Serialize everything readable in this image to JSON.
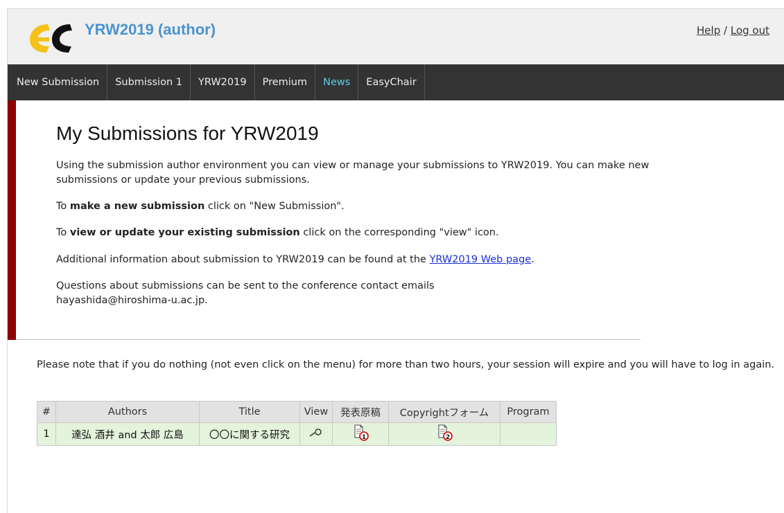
{
  "header": {
    "title": "YRW2019 (author)",
    "help_link": "Help",
    "separator": "/",
    "logout_link": "Log out"
  },
  "menu": {
    "items": [
      {
        "label": "New Submission"
      },
      {
        "label": "Submission 1"
      },
      {
        "label": "YRW2019"
      },
      {
        "label": "Premium"
      },
      {
        "label": "News"
      },
      {
        "label": "EasyChair"
      }
    ],
    "active_item": "News"
  },
  "content": {
    "title": "My Submissions for YRW2019",
    "intro": "Using the submission author environment you can view or manage your submissions to YRW2019. You can make new submissions or update your previous submissions.",
    "new_prefix": "To ",
    "new_bold": "make a new submission",
    "new_suffix": " click on \"New Submission\".",
    "view_prefix": "To ",
    "view_bold": "view or update your existing submission",
    "view_suffix": " click on the corresponding \"view\" icon.",
    "info_prefix": "Additional information about submission to YRW2019 can be found at the ",
    "info_link": "YRW2019 Web page",
    "info_suffix": ".",
    "questions_text": "Questions about submissions can be sent to the conference contact emails",
    "contact_email": "hayashida@hiroshima-u.ac.jp."
  },
  "session_note": "Please note that if you do nothing (not even click on the menu) for more than two hours, your session will expire and you will have to log in again.",
  "table": {
    "columns": [
      "#",
      "Authors",
      "Title",
      "View",
      "発表原稿",
      "Copyrightフォーム",
      "Program"
    ],
    "rows": [
      {
        "num": "1",
        "authors": "達弘 酒井 and 太郎 広島",
        "title": "〇〇に関する研究",
        "view_icon": "magnifier-icon",
        "manuscript_icon": "document-1-icon",
        "copyright_icon": "document-2-icon",
        "program": ""
      }
    ]
  },
  "colors": {
    "accent": "#4a93cf",
    "menu_bg": "#333333",
    "menu_active": "#5ecfe6",
    "side_bar": "#8b0000",
    "row_bg": "#e4f3dc",
    "logo_yellow": "#f5c21a"
  }
}
